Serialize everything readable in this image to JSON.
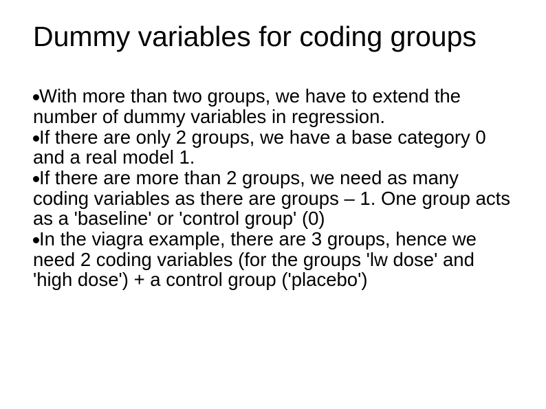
{
  "slide": {
    "title": "Dummy variables for coding groups",
    "bullets": [
      "With more than two groups, we have to extend the number of dummy variables in regression.",
      "If there are only 2 groups, we have a base category 0 and a real model 1.",
      "If there are more than 2 groups, we need as many coding variables as there are groups – 1. One group acts as a 'baseline' or 'control group' (0)",
      "In the viagra example, there are 3 groups, hence we need 2 coding variables (for the groups 'lw dose' and 'high dose') + a control group ('placebo')"
    ]
  }
}
